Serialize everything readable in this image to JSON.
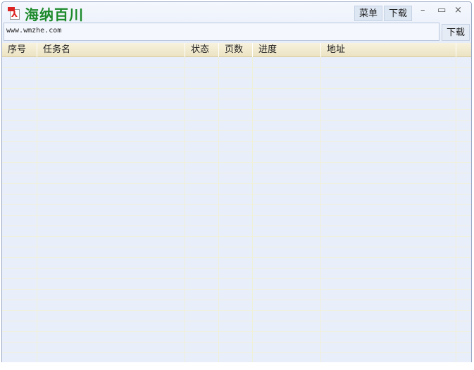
{
  "app": {
    "title": "海纳百川",
    "icon": "pdf-icon"
  },
  "toolbar": {
    "menu_label": "菜单",
    "download_label": "下载",
    "minimize": "–",
    "maximize": "▭",
    "close": "×"
  },
  "address": {
    "value": "www.wmzhe.com",
    "download_button": "下载"
  },
  "table": {
    "columns": [
      "序号",
      "任务名",
      "状态",
      "页数",
      "进度",
      "地址"
    ],
    "rows": []
  }
}
